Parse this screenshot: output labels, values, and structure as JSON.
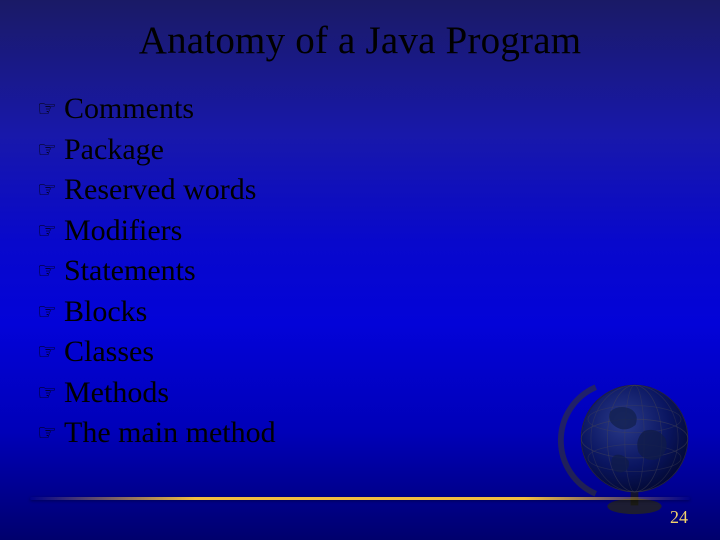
{
  "title": "Anatomy of a Java Program",
  "items": [
    "Comments",
    "Package",
    "Reserved words",
    "Modifiers",
    "Statements",
    "Blocks",
    "Classes",
    "Methods",
    "The main method"
  ],
  "page_number": "24"
}
